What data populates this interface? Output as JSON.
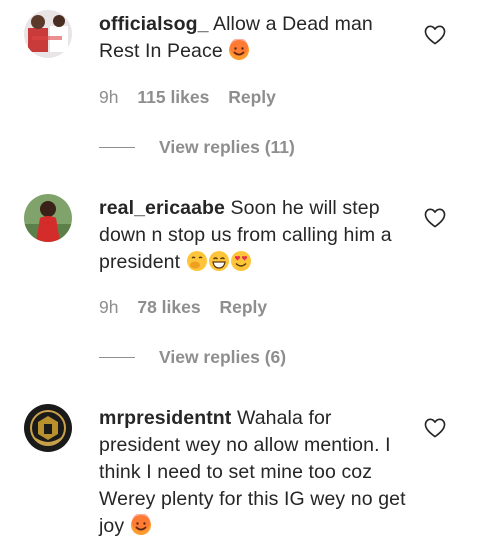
{
  "comments": [
    {
      "username": "officialsog_",
      "text": "Allow a Dead man Rest In Peace",
      "emojis": [
        "hot-face"
      ],
      "time": "9h",
      "likes": "115 likes",
      "reply_label": "Reply",
      "view_replies": "View replies (11)"
    },
    {
      "username": "real_ericaabe",
      "text": "Soon he will step down n stop us from calling him a president",
      "emojis": [
        "face-with-hand-over-mouth",
        "grinning-face",
        "smiling-face-with-heart-eyes"
      ],
      "time": "9h",
      "likes": "78 likes",
      "reply_label": "Reply",
      "view_replies": "View replies (6)"
    },
    {
      "username": "mrpresidentnt",
      "text": "Wahala for president wey no allow mention. I think I need to set mine too coz Werey plenty for this IG wey no get joy",
      "emojis": [
        "hot-face"
      ]
    }
  ],
  "icons": {
    "like": "heart-outline-icon"
  },
  "colors": {
    "text": "#262626",
    "secondary": "#8e8e8e",
    "emoji_face": "#ffb42b"
  }
}
